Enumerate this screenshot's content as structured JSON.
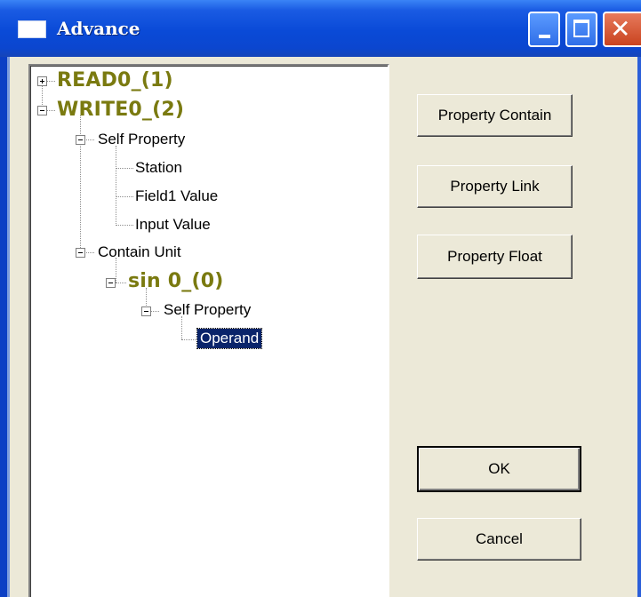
{
  "window": {
    "title": "Advance",
    "controls": [
      "minimize",
      "maximize",
      "close"
    ]
  },
  "tree": {
    "read0": "READ0_(1)",
    "write0": "WRITE0_(2)",
    "self_property": "Self Property",
    "station": "Station",
    "field1_value": "Field1 Value",
    "input_value": "Input Value",
    "contain_unit": "Contain Unit",
    "sin0": "sin 0_(0)",
    "sin_self_property": "Self Property",
    "operand": "Operand"
  },
  "buttons": {
    "property_contain": "Property Contain",
    "property_link": "Property Link",
    "property_float": "Property Float",
    "ok": "OK",
    "cancel": "Cancel"
  },
  "colors": {
    "title_bar": "#0a4ad7",
    "unit_label": "#7a7a10",
    "selection": "#0a246a",
    "dialog_bg": "#ece9d8"
  },
  "icons": {
    "window": "app-window-icon",
    "expand": "plus-box",
    "collapse": "minus-box"
  }
}
